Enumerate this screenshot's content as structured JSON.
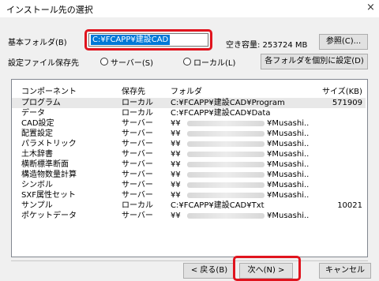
{
  "window": {
    "title": "インストール先の選択",
    "close": "×"
  },
  "base_folder": {
    "label": "基本フォルダ(B)",
    "value": "C:¥FCAPP¥建設CAD"
  },
  "free_space": "空き容量: 253724 MB",
  "browse_button": "参照(C)...",
  "settings": {
    "label": "設定ファイル保存先",
    "radio_server": "サーバー(S)",
    "radio_local": "ローカル(L)",
    "individual_button": "各フォルダを個別に設定(D)"
  },
  "table": {
    "headers": [
      "コンポーネント",
      "保存先",
      "フォルダ",
      "サイズ(KB)"
    ],
    "rows": [
      {
        "component": "プログラム",
        "dest": "ローカル",
        "folder": "C:¥FCAPP¥建設CAD¥Program",
        "size": "571909"
      },
      {
        "component": "データ",
        "dest": "ローカル",
        "folder": "C:¥FCAPP¥建設CAD¥Data",
        "size": ""
      },
      {
        "component": "CAD設定",
        "dest": "サーバー",
        "folder_prefix": "¥¥",
        "folder_suffix": "¥Musashi..",
        "size": ""
      },
      {
        "component": "配置設定",
        "dest": "サーバー",
        "folder_prefix": "¥¥",
        "folder_suffix": "¥Musashi..",
        "size": ""
      },
      {
        "component": "パラメトリック",
        "dest": "サーバー",
        "folder_prefix": "¥¥",
        "folder_suffix": "¥Musashi..",
        "size": ""
      },
      {
        "component": "土木辞書",
        "dest": "サーバー",
        "folder_prefix": "¥¥",
        "folder_suffix": "¥Musashi..",
        "size": ""
      },
      {
        "component": "横断標準断面",
        "dest": "サーバー",
        "folder_prefix": "¥¥",
        "folder_suffix": "¥Musashi..",
        "size": ""
      },
      {
        "component": "構造物数量計算",
        "dest": "サーバー",
        "folder_prefix": "¥¥",
        "folder_suffix": "¥Musashi..",
        "size": ""
      },
      {
        "component": "シンボル",
        "dest": "サーバー",
        "folder_prefix": "¥¥",
        "folder_suffix": "¥Musashi..",
        "size": ""
      },
      {
        "component": "SXF属性セット",
        "dest": "サーバー",
        "folder_prefix": "¥¥",
        "folder_suffix": "¥Musashi..",
        "size": ""
      },
      {
        "component": "サンプル",
        "dest": "ローカル",
        "folder": "C:¥FCAPP¥建設CAD¥Txt",
        "size": "10021"
      },
      {
        "component": "ポケットデータ",
        "dest": "サーバー",
        "folder_prefix": "¥¥",
        "folder_suffix": "¥Musashi..",
        "size": ""
      }
    ]
  },
  "buttons": {
    "back": "< 戻る(B)",
    "next": "次へ(N) >",
    "cancel": "キャンセル"
  },
  "colors": {
    "highlight": "#e0141e",
    "selection": "#0078d7"
  }
}
